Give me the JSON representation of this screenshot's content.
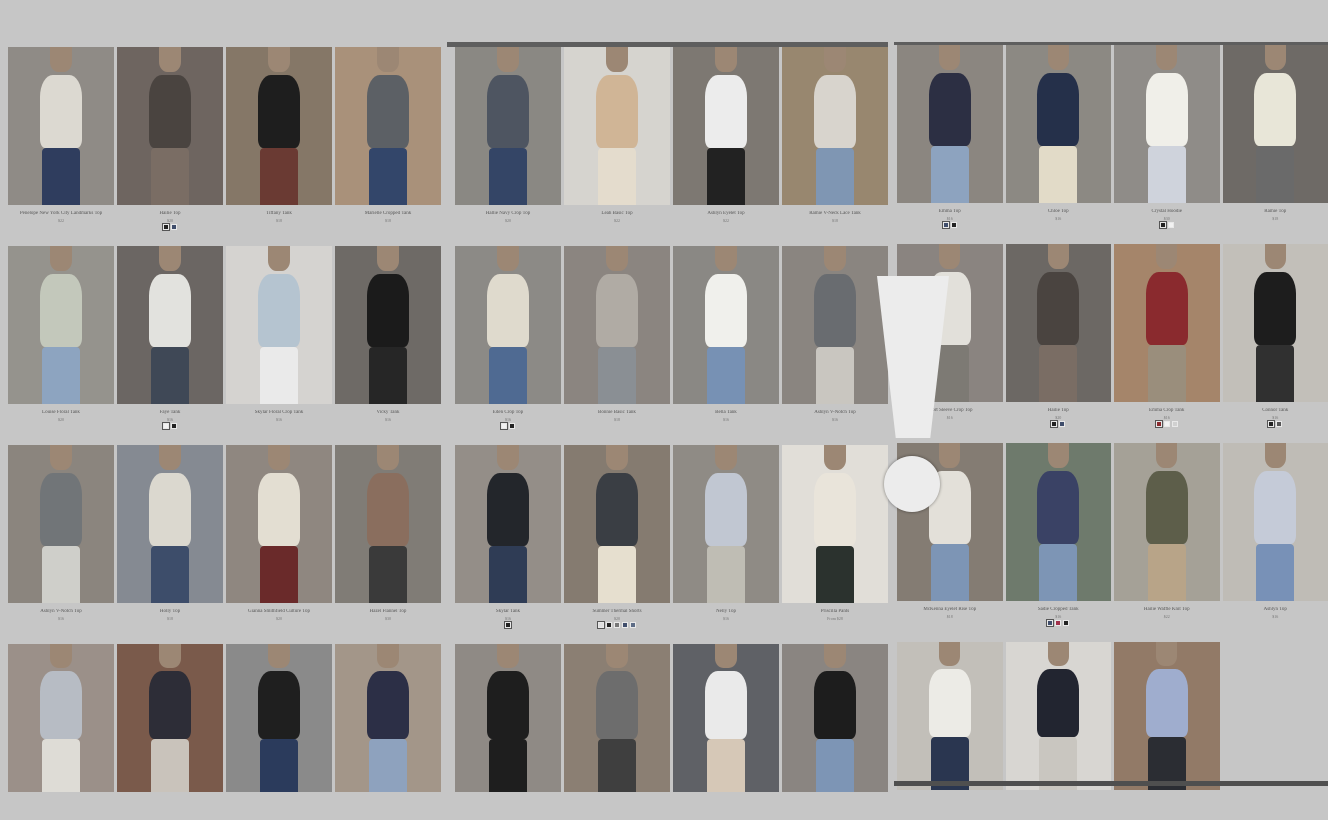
{
  "panels": [
    {
      "rows": [
        [
          {
            "name": "Penelope New York City Landmarks Top",
            "price": "$22",
            "top": "#dcd9d1",
            "bottom": "#2f3d5e",
            "bg": "#8f8b86"
          },
          {
            "name": "Hailie Top",
            "price": "$20",
            "top": "#4a4440",
            "bottom": "#7a6d64",
            "bg": "#6e6560",
            "swatches": [
              "#222222",
              "#3f4d6b"
            ]
          },
          {
            "name": "Tiffany Tank",
            "price": "$18",
            "top": "#1e1e1e",
            "bottom": "#6a3a33",
            "bg": "#857767"
          },
          {
            "name": "Marielle Cropped Tank",
            "price": "$18",
            "top": "#5c6065",
            "bottom": "#33466a",
            "bg": "#a9917a"
          }
        ],
        [
          {
            "name": "Louise Floral Tank",
            "price": "$20",
            "top": "#c3c8bb",
            "bottom": "#8da4c0",
            "bg": "#95938d"
          },
          {
            "name": "Faye Tank",
            "price": "$16",
            "top": "#e2e2de",
            "bottom": "#3f4856",
            "bg": "#6b6663",
            "swatches": [
              "#f2f2f2",
              "#222222"
            ]
          },
          {
            "name": "Skylar Floral Crop Tank",
            "price": "$16",
            "top": "#b5c4d0",
            "bottom": "#eaeaea",
            "bg": "#d5d3d0"
          },
          {
            "name": "Vicky Tank",
            "price": "$16",
            "top": "#1b1b1b",
            "bottom": "#262626",
            "bg": "#6e6a66"
          }
        ],
        [
          {
            "name": "Ashlyn V-Notch Top",
            "price": "$16",
            "top": "#717578",
            "bottom": "#cfcfca",
            "bg": "#8b857e"
          },
          {
            "name": "Holly Top",
            "price": "$18",
            "top": "#dbd8cf",
            "bottom": "#3d4d6a",
            "bg": "#858a92"
          },
          {
            "name": "Gianna Smithfield Culture Top",
            "price": "$20",
            "top": "#e3ded2",
            "bottom": "#6a2a2a",
            "bg": "#8f8780"
          },
          {
            "name": "Hazel Flannel Top",
            "price": "$30",
            "top": "#8a6e5e",
            "bottom": "#3a3a3a",
            "bg": "#807c76"
          }
        ],
        [
          {
            "name": "",
            "price": "",
            "top": "#b7bcc4",
            "bottom": "#dedcd6",
            "bg": "#9b9089"
          },
          {
            "name": "",
            "price": "",
            "top": "#2d2d37",
            "bottom": "#c9c3bb",
            "bg": "#7a5a4b"
          },
          {
            "name": "",
            "price": "",
            "top": "#1f1f1f",
            "bottom": "#2b3b5c",
            "bg": "#8a8a8a"
          },
          {
            "name": "",
            "price": "",
            "top": "#2c2f46",
            "bottom": "#8ea2be",
            "bg": "#a39689"
          }
        ]
      ]
    },
    {
      "rows": [
        [
          {
            "name": "Hallie Navy Crop Top",
            "price": "$20",
            "top": "#4e5561",
            "bottom": "#344566",
            "bg": "#8a8883"
          },
          {
            "name": "Leah Basic Top",
            "price": "$22",
            "top": "#d0b596",
            "bottom": "#e4dccd",
            "bg": "#d6d4cf"
          },
          {
            "name": "Ashlyn Eyelet Top",
            "price": "$22",
            "top": "#ececec",
            "bottom": "#222222",
            "bg": "#7d7872"
          },
          {
            "name": "Ramie V-Neck Lace Tank",
            "price": "$18",
            "top": "#d8d4cd",
            "bottom": "#7f96b3",
            "bg": "#98876f"
          }
        ],
        [
          {
            "name": "Eden Crop Top",
            "price": "$16",
            "top": "#dfdacd",
            "bottom": "#4f6a92",
            "bg": "#8c8a86",
            "swatches": [
              "#f2f2f2",
              "#222222"
            ]
          },
          {
            "name": "Bonnie Basic Tank",
            "price": "$18",
            "top": "#b0aba4",
            "bottom": "#8a8f94",
            "bg": "#8b8580"
          },
          {
            "name": "Bella Tank",
            "price": "$16",
            "top": "#f0f0ec",
            "bottom": "#7791b4",
            "bg": "#8a8884"
          },
          {
            "name": "Ashlyn V-Notch Top",
            "price": "$16",
            "top": "#696c70",
            "bottom": "#c9c6c0",
            "bg": "#8a8580"
          }
        ],
        [
          {
            "name": "Skylar Tank",
            "price": "$16",
            "top": "#23262b",
            "bottom": "#2f3c55",
            "bg": "#948e88",
            "swatches": [
              "#222222"
            ]
          },
          {
            "name": "Summer Thermal Shorts",
            "price": "$20",
            "top": "#3a3e44",
            "bottom": "#e6dfcf",
            "bg": "#857b70",
            "swatches": [
              "#e0e0e0",
              "#222222",
              "#777777",
              "#3f4d6b",
              "#5d6c86"
            ]
          },
          {
            "name": "Nelly Top",
            "price": "$16",
            "top": "#c1c7d2",
            "bottom": "#bfbdb4",
            "bg": "#8f8b85"
          },
          {
            "name": "Priscilla Pants",
            "price": "From $28",
            "top": "#e9e4da",
            "bottom": "#2b322e",
            "bg": "#e1ded8"
          }
        ],
        [
          {
            "name": "",
            "price": "",
            "top": "#1e1e1e",
            "bottom": "#1e1e1e",
            "bg": "#8f8a85"
          },
          {
            "name": "",
            "price": "",
            "top": "#6d6d6d",
            "bottom": "#3f3f3f",
            "bg": "#8b7f73"
          },
          {
            "name": "",
            "price": "",
            "top": "#eaeaea",
            "bottom": "#d6c8b7",
            "bg": "#5f6166"
          },
          {
            "name": "",
            "price": "",
            "top": "#1d1d1d",
            "bottom": "#7d95b5",
            "bg": "#8a8581"
          }
        ]
      ]
    },
    {
      "rows": [
        [
          {
            "name": "Emma Top",
            "price": "$16",
            "top": "#2c2f43",
            "bottom": "#8da3bf",
            "bg": "#8b8680",
            "swatches": [
              "#3f4d6b",
              "#222222"
            ]
          },
          {
            "name": "Chloe Top",
            "price": "$16",
            "top": "#25304a",
            "bottom": "#e2dbc8",
            "bg": "#8c8983"
          },
          {
            "name": "Crystal Hoodie",
            "price": "$30",
            "top": "#f0efe9",
            "bottom": "#cfd3dc",
            "bg": "#8f8c88",
            "swatches": [
              "#222222",
              "#f2f2f2"
            ]
          },
          {
            "name": "Ramie Top",
            "price": "$18",
            "top": "#e8e6d8",
            "bottom": "#6a6a6a",
            "bg": "#6e6a66"
          }
        ],
        [
          {
            "name": "Short Sleeve Crop Top",
            "price": "$16",
            "top": "#e2e0da",
            "bottom": "#7d7a74",
            "bg": "#8a8480"
          },
          {
            "name": "Hailie Top",
            "price": "$20",
            "top": "#4a4440",
            "bottom": "#7a6d64",
            "bg": "#6c6864",
            "swatches": [
              "#222222",
              "#3f4d6b"
            ]
          },
          {
            "name": "Emma Crop Tank",
            "price": "$16",
            "top": "#8a2a2e",
            "bottom": "#9a8e7c",
            "bg": "#a5856a",
            "swatches": [
              "#8a2a2e",
              "#f2f2f2",
              "#d0d0d0"
            ]
          },
          {
            "name": "Connor Tank",
            "price": "$16",
            "top": "#1d1d1d",
            "bottom": "#303030",
            "bg": "#c2bfb9",
            "swatches": [
              "#222222",
              "#555555"
            ]
          }
        ],
        [
          {
            "name": "McKenna Eyelet Rise Top",
            "price": "$18",
            "top": "#e3e0d9",
            "bottom": "#7d95b5",
            "bg": "#847c73"
          },
          {
            "name": "Sadie Cropped Tank",
            "price": "$16",
            "top": "#3a4265",
            "bottom": "#7d95b5",
            "bg": "#6e7a6c",
            "swatches": [
              "#3f4d6b",
              "#a0304a",
              "#222222"
            ]
          },
          {
            "name": "Hailie Waffle Knit Top",
            "price": "$22",
            "top": "#5d5e4a",
            "bottom": "#b8a488",
            "bg": "#a5a197"
          },
          {
            "name": "Ashlyn Top",
            "price": "$16",
            "top": "#c5cbd8",
            "bottom": "#7891b7",
            "bg": "#bfbcb6"
          }
        ],
        [
          {
            "name": "",
            "price": "",
            "top": "#ecebe6",
            "bottom": "#2a3650",
            "bg": "#c2bfb9"
          },
          {
            "name": "",
            "price": "",
            "top": "#222530",
            "bottom": "#c9c6c0",
            "bg": "#d8d6d2"
          },
          {
            "name": "",
            "price": "",
            "top": "#9fadce",
            "bottom": "#2b2d33",
            "bg": "#927a67"
          },
          {
            "name": "",
            "price": "",
            "top": "#c6c6c6",
            "bottom": "#c6c6c6",
            "bg": "#c6c6c6",
            "empty": true
          }
        ]
      ]
    }
  ],
  "overlay": {
    "icon": "exclamation-icon",
    "color": "#ececec"
  }
}
